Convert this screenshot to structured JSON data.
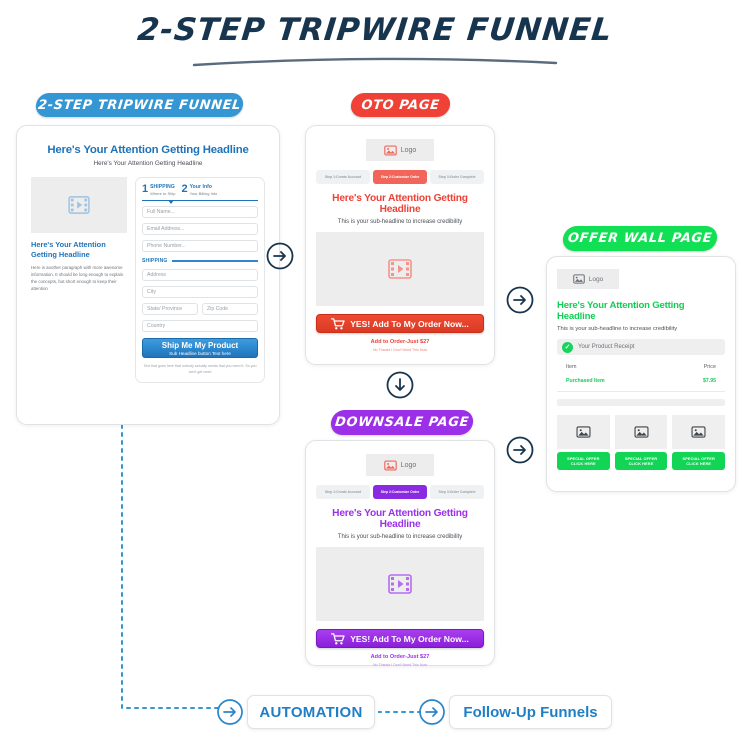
{
  "title": "2-STEP TRIPWIRE FUNNEL",
  "colors": {
    "blue": "#3596d4",
    "red": "#ef4136",
    "green": "#11e055",
    "purple": "#9b30e8",
    "navy": "#17354f",
    "link_blue": "#1f7fc6"
  },
  "badges": {
    "tripwire": "2-STEP TRIPWIRE FUNNEL",
    "oto": "OTO PAGE",
    "offerwall": "OFFER WALL PAGE",
    "downsale": "DOWNSALE PAGE"
  },
  "tripwire_card": {
    "headline": "Here's Your Attention Getting Headline",
    "subheadline": "Here's Your Attention Getting Headline",
    "video_icon": "video-placeholder-icon",
    "left_headline": "Here's Your Attention Getting Headline",
    "left_paragraph": "Here is another paragraph with more awesome information. It should be long enough to explain the concepts, but short enough to keep their attention",
    "steps": [
      {
        "num": "1",
        "title": "SHIPPING",
        "sub": "Where to Ship"
      },
      {
        "num": "2",
        "title": "Your Info",
        "sub": "Your Billing Info"
      }
    ],
    "fields": [
      "Full Name...",
      "Email Address...",
      "Phone Number..."
    ],
    "section_label": "SHIPPING",
    "address_fields": [
      "Address",
      "City"
    ],
    "split_fields": [
      "State/ Province",
      "Zip Code"
    ],
    "country_field": "Country",
    "button_main": "Ship Me My Product",
    "button_sub": "Sub Headline button Text here",
    "fine_print": "Text that goes here that nobody actually needs that you need it. So you don't get need"
  },
  "oto_card": {
    "logo_label": "Logo",
    "logo_icon": "image-placeholder-icon",
    "tabs": [
      {
        "label": "Step 1:Create Account",
        "active": false
      },
      {
        "label": "Step 2:Customize Order",
        "active": true
      },
      {
        "label": "Step 3:Order Complete",
        "active": false
      }
    ],
    "headline": "Here's Your Attention Getting Headline",
    "subheadline": "This is your sub-headline to increase credibility",
    "video_icon": "video-placeholder-icon",
    "cta_icon": "shopping-cart-icon",
    "cta_label": "YES! Add To My Order Now...",
    "price_line": "Add to Order-Just $27",
    "deny_line": "No Thanks I Don't Need This Now"
  },
  "downsale_card": {
    "logo_label": "Logo",
    "logo_icon": "image-placeholder-icon",
    "tabs": [
      {
        "label": "Step 1:Create Account",
        "active": false
      },
      {
        "label": "Step 2:Customize Order",
        "active": true
      },
      {
        "label": "Step 3:Order Complete",
        "active": false
      }
    ],
    "headline": "Here's Your Attention Getting Headline",
    "subheadline": "This is your sub-headline to increase credibility",
    "video_icon": "video-placeholder-icon",
    "cta_icon": "shopping-cart-icon",
    "cta_label": "YES! Add To My Order Now...",
    "price_line": "Add to Order-Just $27",
    "deny_line": "No Thanks I Don't Need This Now"
  },
  "offerwall_card": {
    "logo_label": "Logo",
    "logo_icon": "image-placeholder-icon",
    "headline": "Here's Your Attention Getting Headline",
    "subheadline": "This is your sub-headline to increase credibility",
    "receipt_label": "Your Product Receipt",
    "check_icon": "check-circle-icon",
    "table": {
      "headers": [
        "Item",
        "Price"
      ],
      "rows": [
        {
          "item": "Purchased Item",
          "price": "$7.95"
        }
      ]
    },
    "offers": [
      {
        "thumb_icon": "image-placeholder-icon",
        "line1": "SPECIAL OFFER",
        "line2": "CLICK HERE"
      },
      {
        "thumb_icon": "image-placeholder-icon",
        "line1": "SPECIAL OFFER",
        "line2": "CLICK HERE"
      },
      {
        "thumb_icon": "image-placeholder-icon",
        "line1": "SPECIAL OFFER",
        "line2": "CLICK HERE"
      }
    ]
  },
  "footer": {
    "automation": "AUTOMATION",
    "followup": "Follow-Up Funnels"
  },
  "arrows": {
    "right_icon": "arrow-right-circle-icon",
    "down_icon": "arrow-down-circle-icon"
  }
}
